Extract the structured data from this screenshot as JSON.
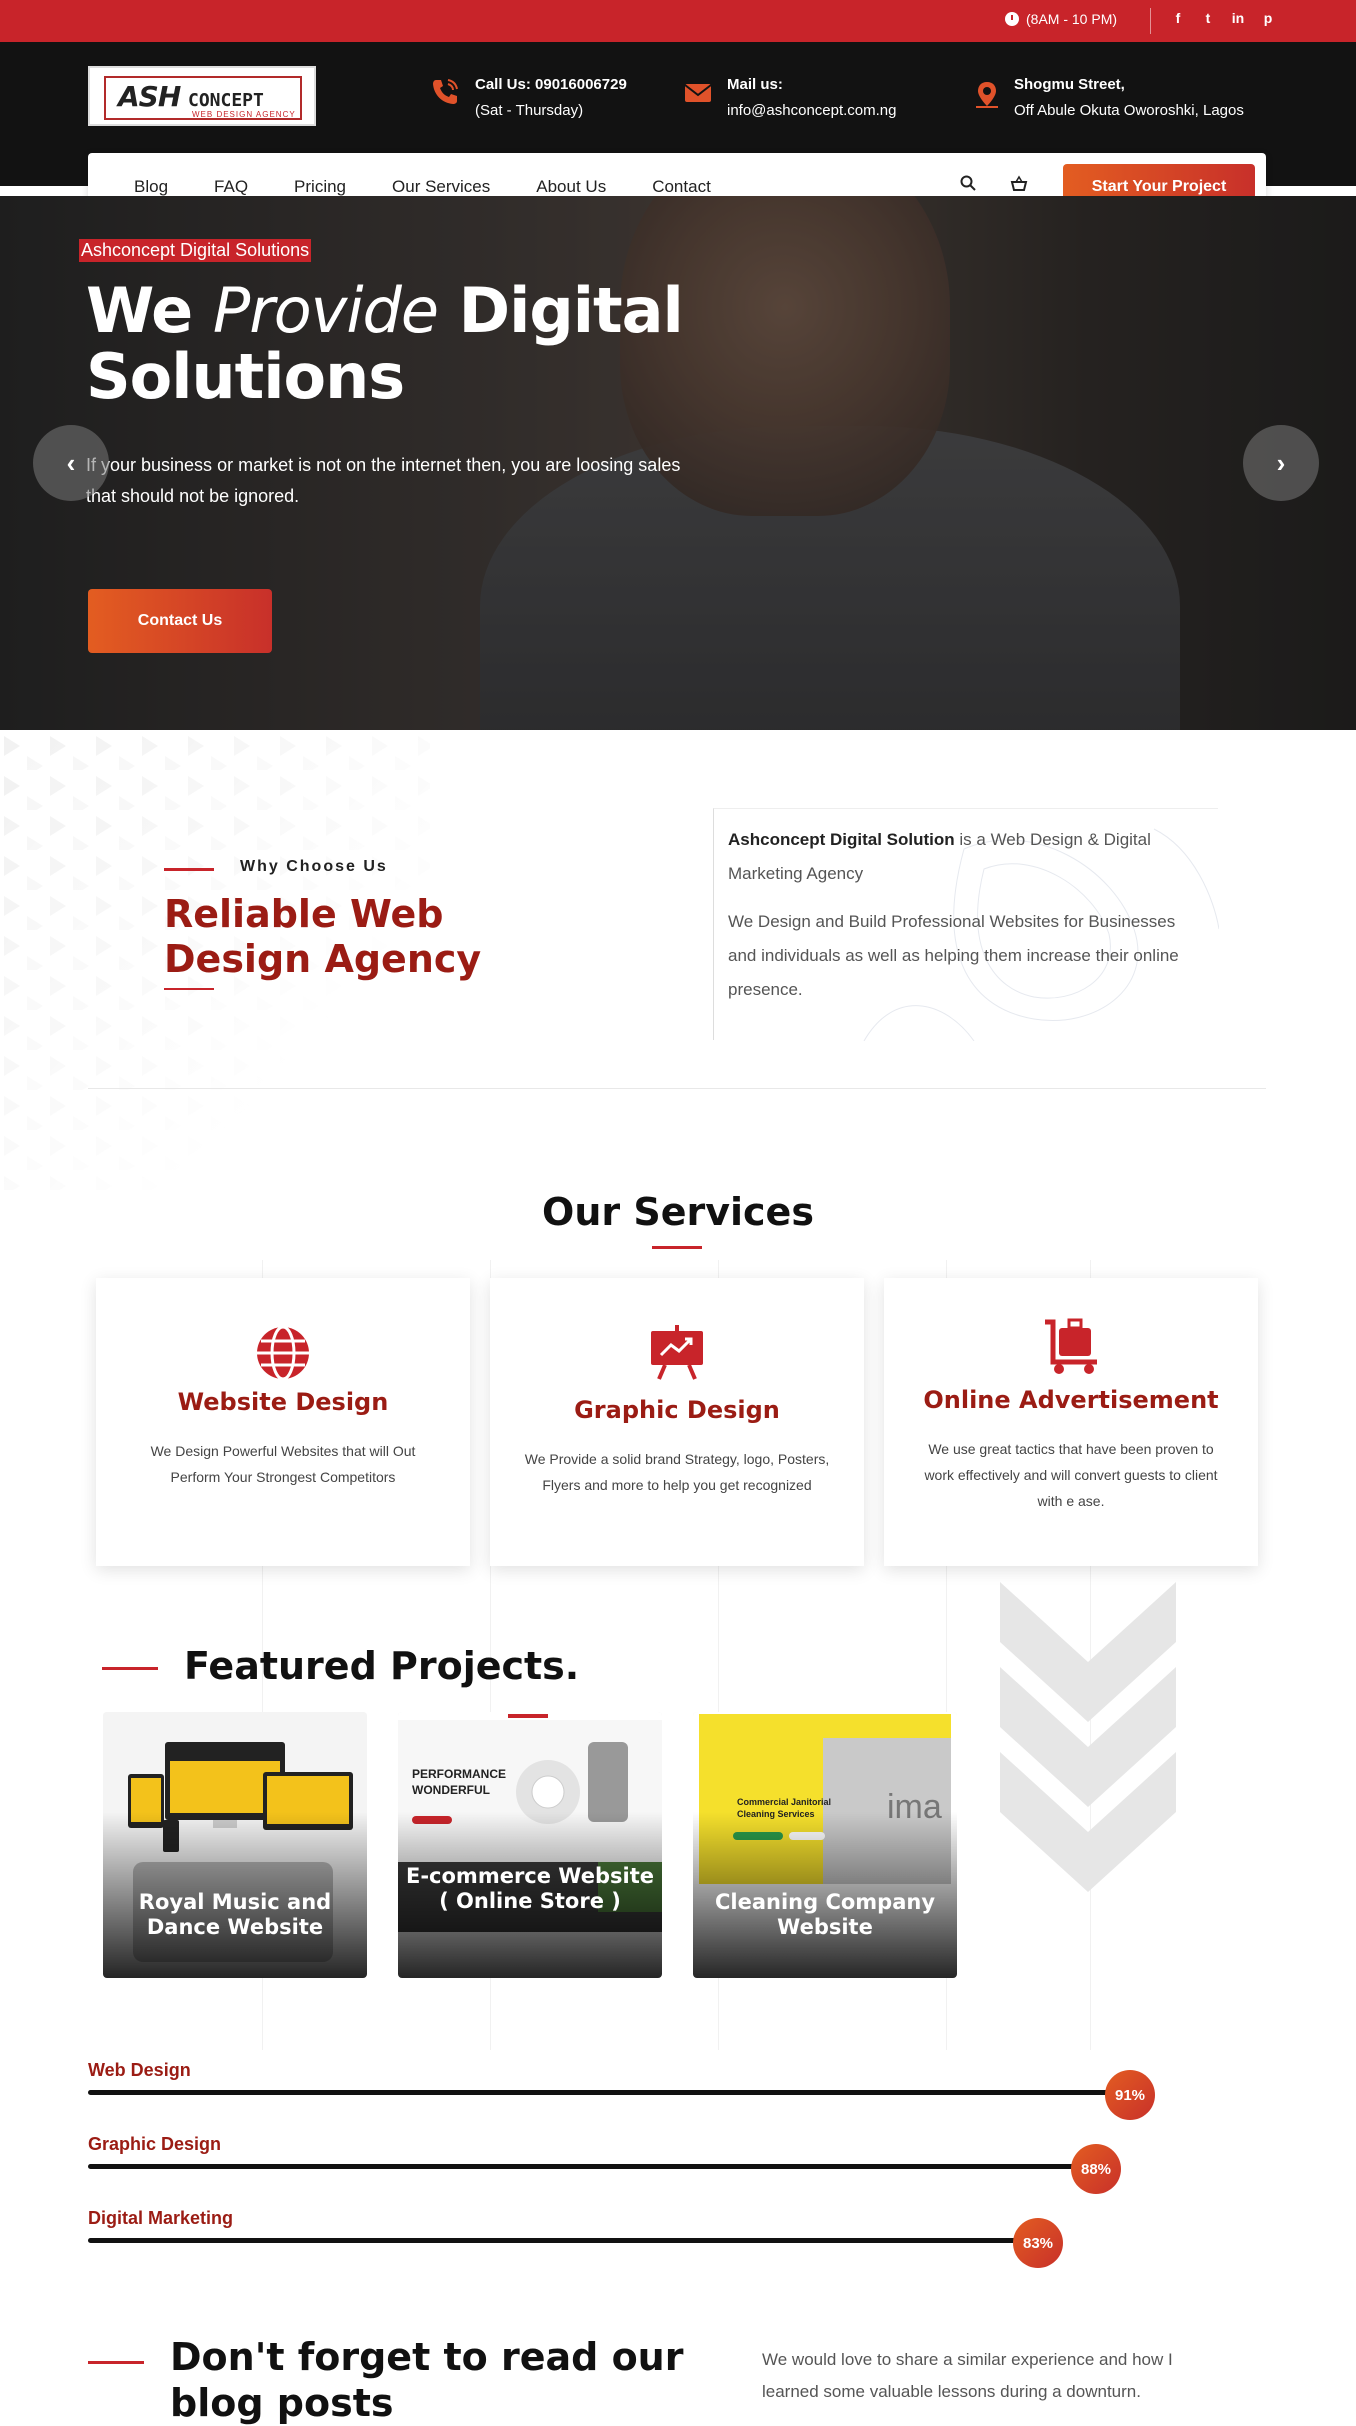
{
  "topbar": {
    "hours": "(8AM - 10 PM)",
    "social": [
      {
        "icon": "facebook-icon",
        "glyph": "f"
      },
      {
        "icon": "twitter-icon",
        "glyph": "t"
      },
      {
        "icon": "linkedin-icon",
        "glyph": "in"
      },
      {
        "icon": "pinterest-icon",
        "glyph": "p"
      }
    ]
  },
  "logo": {
    "ash": "ASH",
    "concept": "CONCEPT",
    "tagline": "WEB DESIGN AGENCY"
  },
  "contacts": {
    "phone_title": "Call Us: 09016006729",
    "phone_sub": "(Sat - Thursday)",
    "mail_title": "Mail us:",
    "mail_sub": "info@ashconcept.com.ng",
    "address_title": "Shogmu Street,",
    "address_sub": "Off Abule Okuta Oworoshki, Lagos"
  },
  "nav": {
    "items": [
      "Blog",
      "FAQ",
      "Pricing",
      "Our Services",
      "About Us",
      "Contact"
    ],
    "cta": "Start Your Project"
  },
  "hero": {
    "tag": "Ashconcept Digital Solutions",
    "h_we": "We",
    "h_provide": "Provide",
    "h_digital": "Digital",
    "h_solutions": "Solutions",
    "desc": "If your business or market is not on the internet then, you are loosing sales that should not be ignored.",
    "button": "Contact Us"
  },
  "why": {
    "kicker": "Why Choose Us",
    "title": "Reliable Web Design Agency",
    "p1_bold": "Ashconcept Digital Solution",
    "p1_rest": " is a Web Design & Digital Marketing Agency",
    "p2": "We Design and Build Professional Websites for Businesses and individuals as  well as helping them increase their online presence."
  },
  "services": {
    "title": "Our Services",
    "cards": [
      {
        "title": "Website Design",
        "text": "We Design Powerful Websites that will Out Perform Your Strongest Competitors"
      },
      {
        "title": "Graphic Design",
        "text": "We Provide a solid brand Strategy, logo, Posters, Flyers and more to help you get recognized"
      },
      {
        "title": "Online Advertisement",
        "text": "We use great tactics that have been proven to work effectively and will convert guests to client with e ase."
      }
    ]
  },
  "projects": {
    "title": "Featured Projects.",
    "items": [
      {
        "label": "Royal Music and Dance Website"
      },
      {
        "label": "E-commerce Website ( Online Store )",
        "thumb_text1": "PERFORMANCE",
        "thumb_text2": "WONDERFUL"
      },
      {
        "label": "Cleaning Company Website",
        "thumb_text1": "Commercial Janitorial",
        "thumb_text2": "Cleaning Services",
        "placeholder": "ima"
      }
    ]
  },
  "skills": [
    {
      "name": "Web Design",
      "percent": 91,
      "label": "91%"
    },
    {
      "name": "Graphic Design",
      "percent": 88,
      "label": "88%"
    },
    {
      "name": "Digital Marketing",
      "percent": 83,
      "label": "83%"
    }
  ],
  "blog": {
    "title": "Don't forget to read our blog posts",
    "text": "We would love to share a similar experience and how I learned some valuable lessons during a downturn."
  }
}
